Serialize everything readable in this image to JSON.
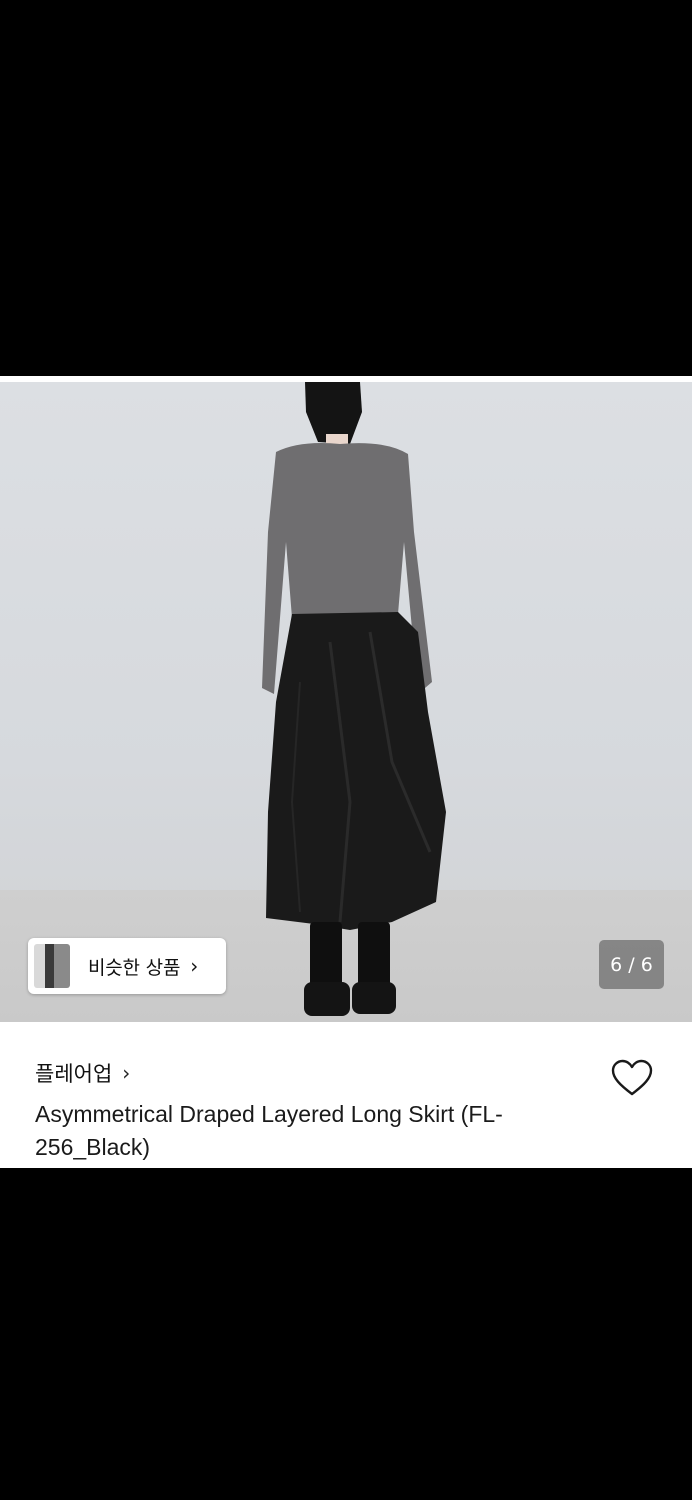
{
  "gallery": {
    "similar_products_label": "비슷한 상품",
    "similar_chevron": "›",
    "page_indicator": "6 / 6"
  },
  "product": {
    "brand": "플레어업",
    "brand_chevron": "›",
    "title": "Asymmetrical Draped Layered Long Skirt (FL-256_Black)"
  },
  "icons": {
    "wishlist": "heart-outline-icon",
    "chevron": "chevron-right-icon"
  },
  "colors": {
    "background": "#000000",
    "card": "#ffffff",
    "indicator_bg": "#6e6e6e"
  }
}
